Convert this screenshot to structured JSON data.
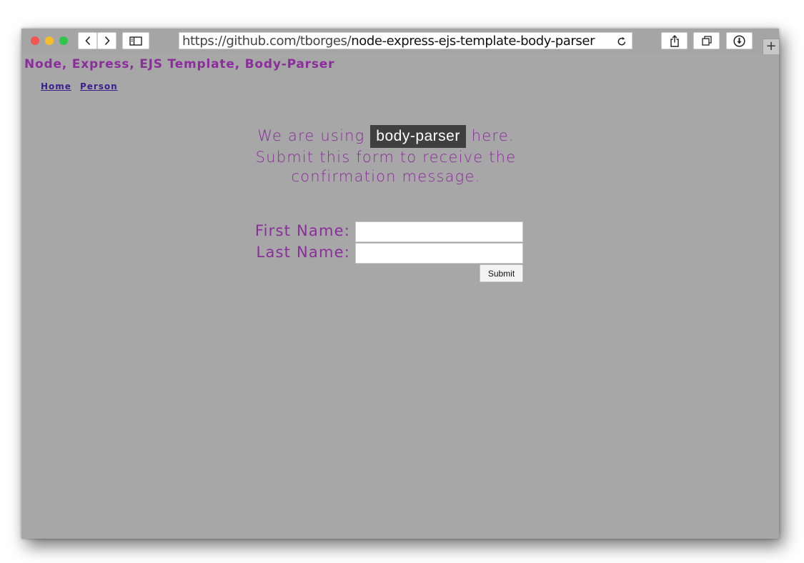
{
  "browser": {
    "url_base": "https://github.com/tborges/",
    "url_path": "node-express-ejs-template-body-parser",
    "new_tab_label": "+"
  },
  "site": {
    "title": "Node, Express, EJS Template, Body-Parser",
    "nav": [
      "Home",
      "Person"
    ]
  },
  "intro": {
    "before_code": "We are using ",
    "code": "body-parser",
    "after_code": " here. Submit this form to receive the confirmation message."
  },
  "form": {
    "first_name_label": "First Name:",
    "first_name_value": "",
    "last_name_label": "Last Name:",
    "last_name_value": "",
    "submit_label": "Submit"
  },
  "colors": {
    "accent": "#8a2e9a",
    "nav_link": "#3b1f8c",
    "page_background": "#a7a7a7",
    "code_chip": "#3f3f3f"
  },
  "icons": [
    "close-dot-icon",
    "minimize-dot-icon",
    "zoom-dot-icon",
    "chevron-left-icon",
    "chevron-right-icon",
    "sidebar-icon",
    "reload-icon",
    "share-icon",
    "tabs-icon",
    "download-icon",
    "plus-icon"
  ]
}
